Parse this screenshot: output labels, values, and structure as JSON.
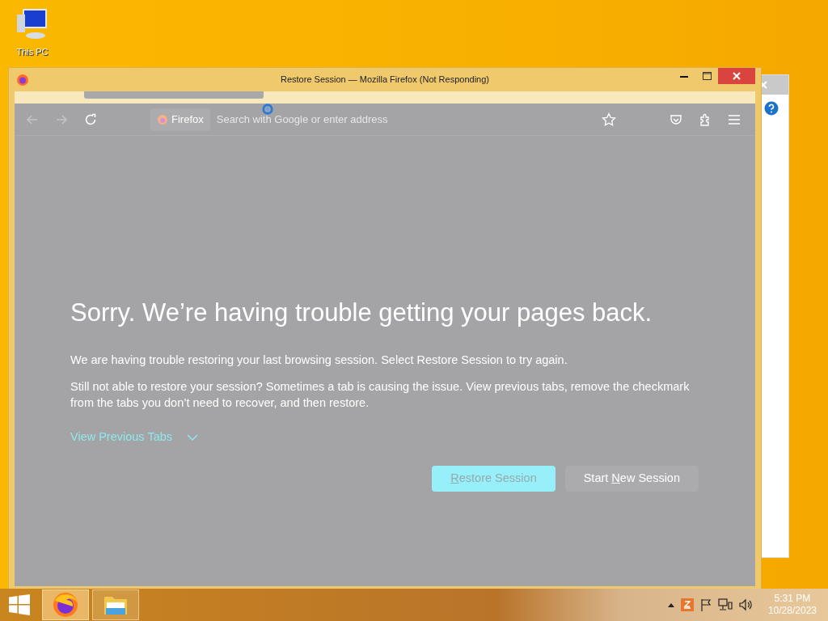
{
  "desktop_icons": [
    {
      "label": "This PC"
    }
  ],
  "window": {
    "title": "Restore Session — Mozilla Firefox (Not Responding)"
  },
  "nav_buttons": [
    {
      "kind": "back",
      "disabled": true
    },
    {
      "kind": "forward",
      "disabled": true
    },
    {
      "kind": "reload",
      "disabled": false
    }
  ],
  "address_bar": {
    "identity": "Firefox",
    "placeholder": "Search with Google or enter address"
  },
  "page": {
    "heading": "Sorry. We’re having trouble getting your pages back.",
    "paragraphs": [
      "We are having trouble restoring your last browsing session. Select Restore Session to try again.",
      "Still not able to restore your session? Sometimes a tab is causing the issue. View previous tabs, remove the checkmark from the tabs you don’t need to recover, and then restore."
    ],
    "toggle": {
      "label": "View Previous Tabs",
      "expanded": false
    },
    "buttons": [
      {
        "kind": "primary",
        "key": "R",
        "after": "estore Session"
      },
      {
        "kind": "secondary",
        "before": "Start ",
        "key": "N",
        "after": "ew Session"
      }
    ]
  },
  "taskbar": {
    "apps": [
      {
        "kind": "firefox",
        "selected": true
      },
      {
        "kind": "explorer",
        "selected": false
      }
    ],
    "time": "5:31 PM",
    "date": "10/28/2023"
  }
}
